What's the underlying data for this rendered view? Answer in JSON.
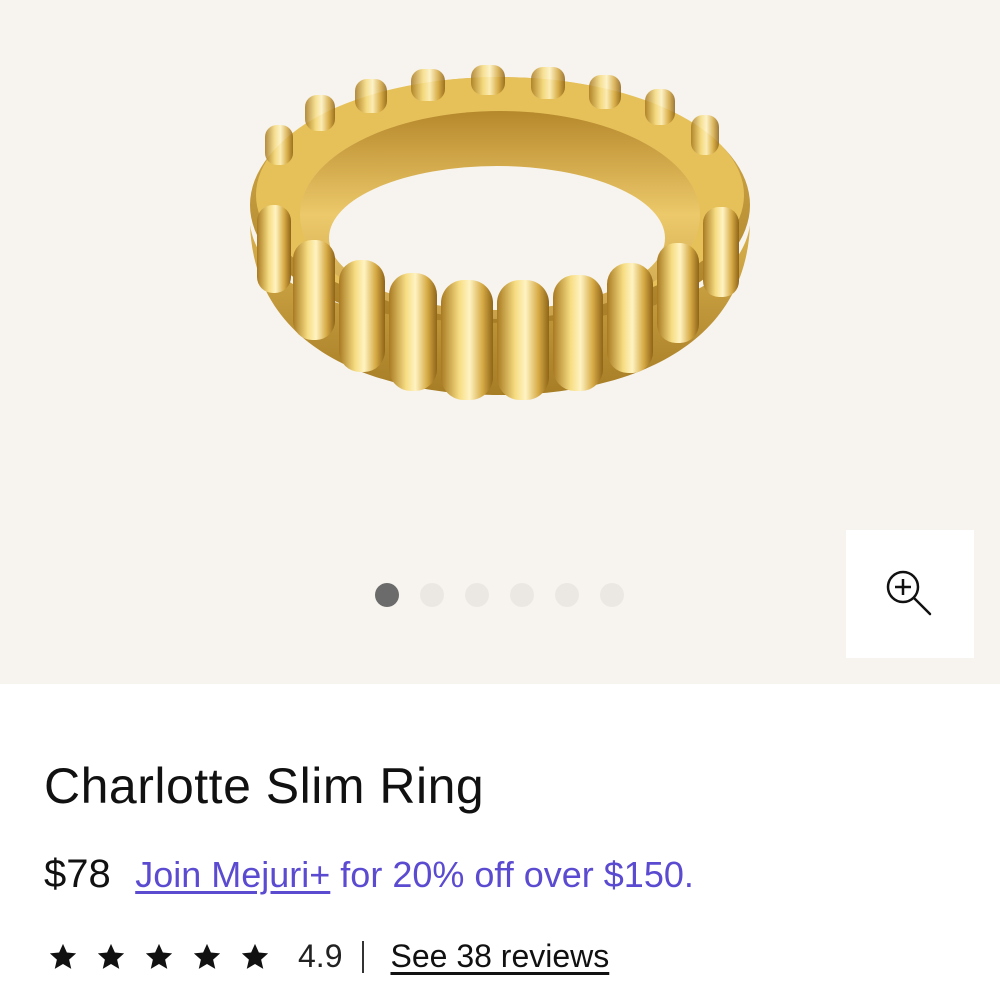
{
  "product": {
    "title": "Charlotte Slim Ring",
    "price": "$78",
    "promo": {
      "link_text": "Join Mejuri+",
      "rest_text": " for 20% off over $150."
    },
    "rating": {
      "stars": 5,
      "value": "4.9",
      "reviews_link": "See 38 reviews"
    }
  },
  "gallery": {
    "total_images": 6,
    "active_index": 0,
    "zoom_icon": "zoom-in-icon"
  },
  "colors": {
    "gallery_background": "#f7f4ef",
    "promo_link": "#5b4bd1",
    "active_dot": "#6b6b6b",
    "inactive_dot": "#ebe8e3",
    "gold": "#e0b848"
  }
}
